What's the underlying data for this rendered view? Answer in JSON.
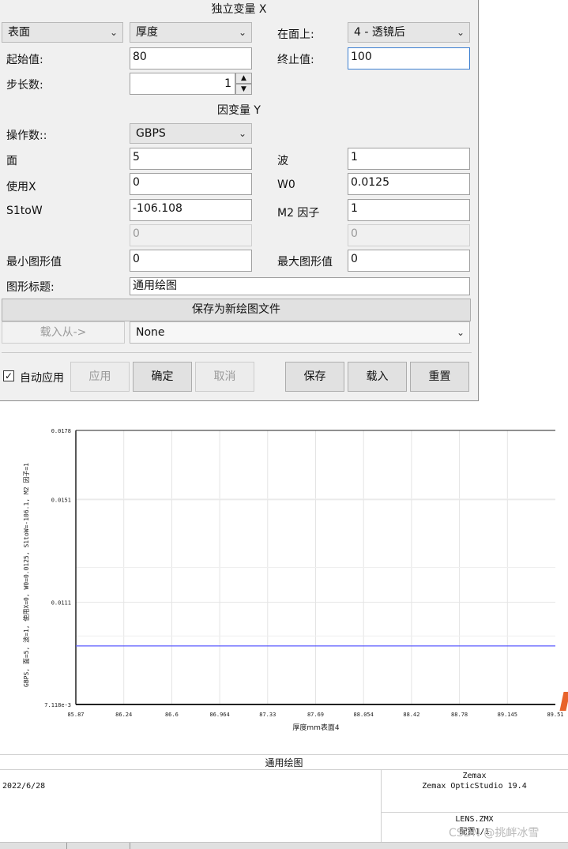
{
  "dialog": {
    "section_x": "独立变量 X",
    "section_y": "因变量 Y",
    "var_type": "表面",
    "param": "厚度",
    "on_surface_label": "在面上:",
    "on_surface_value": "4 - 透镜后",
    "start_label": "起始值:",
    "start_value": "80",
    "end_label": "终止值:",
    "end_value": "100",
    "steps_label": "步长数:",
    "steps_value": "1",
    "operand_label": "操作数::",
    "operand_value": "GBPS",
    "surf_label": "面",
    "surf_value": "5",
    "wave_label": "波",
    "wave_value": "1",
    "usex_label": "使用X",
    "usex_value": "0",
    "w0_label": "W0",
    "w0_value": "0.0125",
    "s1tow_label": "S1toW",
    "s1tow_value": "-106.108",
    "m2_label": "M2 因子",
    "m2_value": "1",
    "extra1_value": "0",
    "extra2_value": "0",
    "min_label": "最小图形值",
    "min_value": "0",
    "max_label": "最大图形值",
    "max_value": "0",
    "title_label": "图形标题:",
    "title_value": "通用绘图",
    "save_new_label": "保存为新绘图文件",
    "load_from_label": "载入从->",
    "load_from_value": "None",
    "auto_apply_label": "自动应用",
    "apply_label": "应用",
    "ok_label": "确定",
    "cancel_label": "取消",
    "save_label": "保存",
    "load_label": "载入",
    "reset_label": "重置",
    "auto_apply_checked": true
  },
  "chart_data": {
    "type": "line",
    "title": "",
    "xlabel": "厚度mm表面4",
    "ylabel": "GBPS, 面=5, 波=1, 使用X=0, W0=0.0125, S1toW=-106.1, M2 因子=1",
    "x_ticks": [
      "85.87",
      "86.24",
      "86.6",
      "86.964",
      "87.33",
      "87.69",
      "88.054",
      "88.42",
      "88.78",
      "89.145",
      "89.51"
    ],
    "y_ticks": [
      "7.118e-3",
      "0.0111",
      "0.0151",
      "0.0178"
    ],
    "xlim": [
      85.87,
      89.51
    ],
    "ylim": [
      0.007118,
      0.0178
    ],
    "series": [
      {
        "color": "#5b5bff",
        "x": [
          85.87,
          89.51
        ],
        "y": [
          0.0094,
          0.0094
        ]
      }
    ],
    "grid": true
  },
  "info": {
    "title": "通用绘图",
    "date": "2022/6/28",
    "vendor": "Zemax",
    "product": "Zemax OpticStudio 19.4",
    "file": "LENS.ZMX",
    "config": "配置1/1",
    "watermark": "CSDN @挑衅冰雪"
  }
}
